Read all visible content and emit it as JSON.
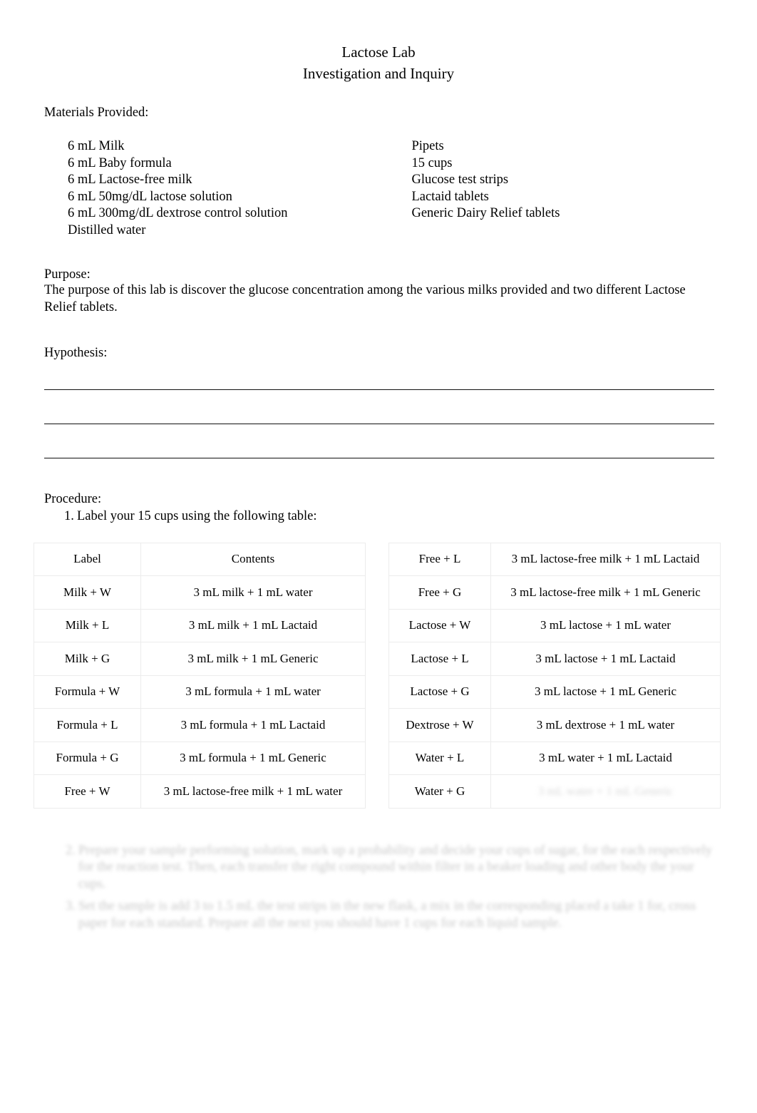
{
  "document": {
    "title_line1": "Lactose Lab",
    "title_line2": "Investigation and Inquiry"
  },
  "materials": {
    "heading": "Materials Provided:",
    "left_column": [
      "6 mL Milk",
      "6 mL Baby formula",
      "6 mL Lactose-free milk",
      "6 mL 50mg/dL lactose solution",
      "6 mL 300mg/dL dextrose control solution",
      "Distilled water"
    ],
    "right_column": [
      "Pipets",
      "15 cups",
      "Glucose test strips",
      "Lactaid tablets",
      "Generic Dairy Relief tablets"
    ]
  },
  "purpose": {
    "heading": "Purpose:",
    "text": "The purpose of this lab is discover the glucose concentration among the various milks provided and two different Lactose Relief tablets."
  },
  "hypothesis": {
    "heading": "Hypothesis:",
    "answer_lines": [
      "",
      "",
      ""
    ]
  },
  "procedure": {
    "heading": "Procedure:",
    "steps": [
      {
        "number": "1.",
        "text": "Label your 15 cups using the following table:"
      }
    ],
    "faded_steps": [
      {
        "number": "2.",
        "text": "Prepare your sample performing solution, mark up a probability and decide your cups of sugar, for the each respectively for the reaction test. Then, each transfer the right compound within filter in a beaker loading and other body the your cups."
      },
      {
        "number": "3.",
        "text": "Set the sample is add 3 to 1.5 mL the test strips in the new flask, a mix in the corresponding placed a take 1 for, cross paper for each standard. Prepare all the next you should have 1 cups for each liquid sample."
      }
    ]
  },
  "cups_table": {
    "headers": [
      "Label",
      "Contents"
    ],
    "left_rows": [
      {
        "label": "Milk + W",
        "contents": "3 mL milk + 1 mL water"
      },
      {
        "label": "Milk + L",
        "contents": "3 mL milk + 1 mL Lactaid"
      },
      {
        "label": "Milk + G",
        "contents": "3 mL milk + 1 mL Generic"
      },
      {
        "label": "Formula + W",
        "contents": "3 mL formula + 1 mL water"
      },
      {
        "label": "Formula + L",
        "contents": "3 mL formula + 1 mL Lactaid"
      },
      {
        "label": "Formula + G",
        "contents": "3 mL formula + 1 mL Generic"
      },
      {
        "label": "Free + W",
        "contents": "3 mL lactose-free milk + 1 mL water"
      }
    ],
    "right_rows": [
      {
        "label": "Free + L",
        "contents": "3 mL lactose-free milk + 1 mL Lactaid",
        "faded": false
      },
      {
        "label": "Free + G",
        "contents": "3 mL lactose-free milk + 1 mL Generic",
        "faded": false
      },
      {
        "label": "Lactose + W",
        "contents": "3 mL lactose + 1 mL water",
        "faded": false
      },
      {
        "label": "Lactose + L",
        "contents": "3 mL lactose + 1 mL Lactaid",
        "faded": false
      },
      {
        "label": "Lactose + G",
        "contents": "3 mL lactose + 1 mL Generic",
        "faded": false
      },
      {
        "label": "Dextrose + W",
        "contents": "3 mL dextrose + 1 mL water",
        "faded": false
      },
      {
        "label": "Water + L",
        "contents": "3 mL water + 1 mL Lactaid",
        "faded": false
      },
      {
        "label": "Water + G",
        "contents": "3 mL water + 1 mL Generic",
        "faded": true
      }
    ]
  },
  "colors": {
    "page_background": "#ffffff",
    "text": "#000000",
    "rule_line": "#111111",
    "table_border": "#ececec"
  }
}
